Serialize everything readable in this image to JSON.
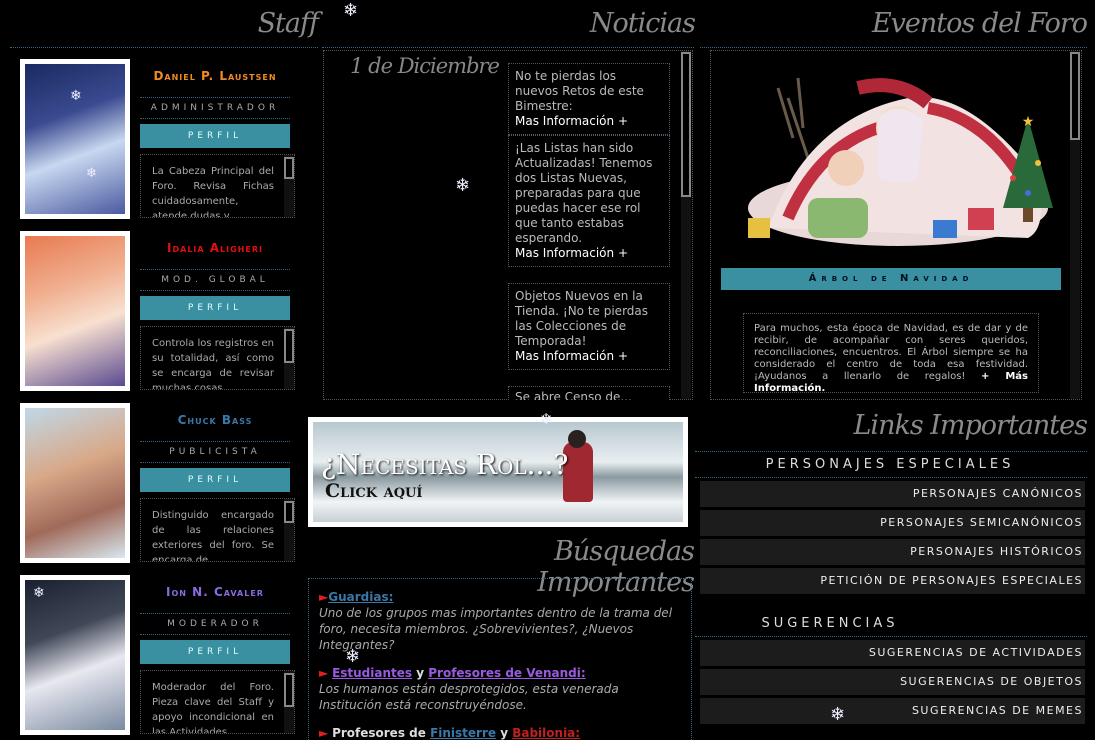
{
  "sections": {
    "staff": "Staff",
    "noticias": "Noticias",
    "eventos": "Eventos del Foro",
    "links": "Links Importantes",
    "busquedas": "Búsquedas Importantes"
  },
  "staff": [
    {
      "name": "Daniel P. Laustsen",
      "color": "#f08a24",
      "role": "ADMINISTRADOR",
      "button": "PERFIL",
      "desc": "La Cabeza Principal del Foro. Revisa Fichas cuidadosamente, atende dudas y..."
    },
    {
      "name": "Idalia Aligheri",
      "color": "#e01010",
      "role": "MOD. GLOBAL",
      "button": "PERFIL",
      "desc": "Controla los registros en su totalidad, así como se encarga de revisar muchas cosas..."
    },
    {
      "name": "Chuck Bass",
      "color": "#3a78a8",
      "role": "PUBLICISTA",
      "button": "PERFIL",
      "desc": "Distinguido encargado de las relaciones exteriores del foro. Se encarga de..."
    },
    {
      "name": "Ion N. Cavaler",
      "color": "#8a6ae0",
      "role": "MODERADOR",
      "button": "PERFIL",
      "desc": "Moderador del Foro. Pieza clave del Staff y apoyo incondicional en las Actividades..."
    }
  ],
  "news": {
    "date": "1 de Diciembre",
    "more": "Mas Información +",
    "items": [
      "No te pierdas los nuevos Retos de este Bimestre:",
      "¡Las Listas han sido Actualizadas! Tenemos dos Listas Nuevas, preparadas para que puedas hacer ese rol que tanto estabas esperando.",
      "Objetos Nuevos en la Tienda. ¡No te pierdas las Colecciones de Temporada!",
      "Se abre Censo de..."
    ]
  },
  "event": {
    "button": "Árbol de Navidad",
    "desc": "Para muchos, esta época de Navidad, es de dar y de recibir, de acompañar con seres queridos, reconciliaciones, encuentros. El Árbol siempre se ha considerado el centro de toda esa festividad. ¡Ayudanos a llenarlo de regalos!",
    "more": "+ Más Información."
  },
  "banner": {
    "line1": "¿Necesitas Rol...?",
    "line2": "Click aquí"
  },
  "links": {
    "head1": "PERSONAJES ESPECIALES",
    "group1": [
      "PERSONAJES CANÓNICOS",
      "PERSONAJES SEMICANÓNICOS",
      "PERSONAJES HISTÓRICOS",
      "PETICIÓN DE PERSONAJES ESPECIALES"
    ],
    "head2": "SUGERENCIAS",
    "group2": [
      "SUGERENCIAS DE ACTIVIDADES",
      "SUGERENCIAS DE OBJETOS",
      "SUGERENCIAS DE MEMES"
    ]
  },
  "search": {
    "r1_title": "Guardias:",
    "r1_desc": "Uno de los grupos mas importantes dentro de la trama del foro, necesita miembros. ¿Sobrevivientes?, ¿Nuevos Integrantes?",
    "r2_a": "Estudiantes",
    "r2_y": " y ",
    "r2_b": "Profesores de Venandi:",
    "r2_desc": "Los humanos están desprotegidos, esta venerada Institución está reconstruyéndose.",
    "r3_a": "Profesores de ",
    "r3_b": "Finisterre",
    "r3_y": " y ",
    "r3_c": "Babilonia:",
    "marker": "►"
  },
  "icons": {
    "snowflake": "snowflake-icon",
    "arrow": "arrow-right-icon"
  }
}
